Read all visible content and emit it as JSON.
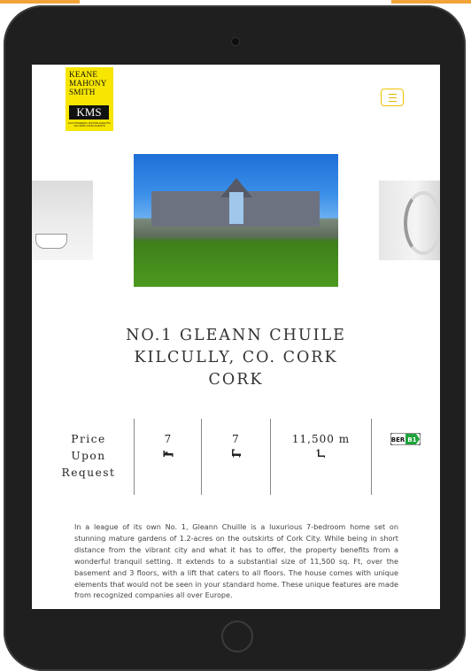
{
  "logo": {
    "line1": "KEANE",
    "line2": "MAHONY",
    "line3": "SMITH",
    "badge": "KMS",
    "tagline": "AUCTIONEERS, ESTATE AGENTS, VALUERS   LAND AGENTS"
  },
  "menu": {
    "icon": "hamburger-icon",
    "accent": "#f0c400"
  },
  "gallery": {
    "left_image": "bathroom-photo",
    "main_image": "house-exterior-photo",
    "right_image": "staircase-photo"
  },
  "address": {
    "line1": "NO.1 GLEANN CHUILE",
    "line2": "KILCULLY, CO. CORK",
    "line3": "CORK"
  },
  "specs": {
    "price_line1": "Price",
    "price_line2": "Upon",
    "price_line3": "Request",
    "bedrooms": "7",
    "bedrooms_icon": "bed-icon",
    "bathrooms": "7",
    "bathrooms_icon": "bath-icon",
    "area": "11,500 m",
    "area_icon": "area-icon",
    "ber_label": "BER",
    "ber_rating": "B1",
    "ber_color": "#1fa33a"
  },
  "description": "In a league of its own No. 1, Gleann Chuille is a luxurious 7-bedroom home set on stunning mature gardens of 1.2-acres on the outskirts of Cork City. While being in short distance from the vibrant city and what it has to offer, the property benefits from a wonderful tranquil setting. It extends to a substantial size of 11,500 sq. Ft, over the basement and 3 floors, with a lift that caters to all floors. The house comes with unique elements that would not be seen in your standard home. These unique features are made from recognized companies all over Europe."
}
